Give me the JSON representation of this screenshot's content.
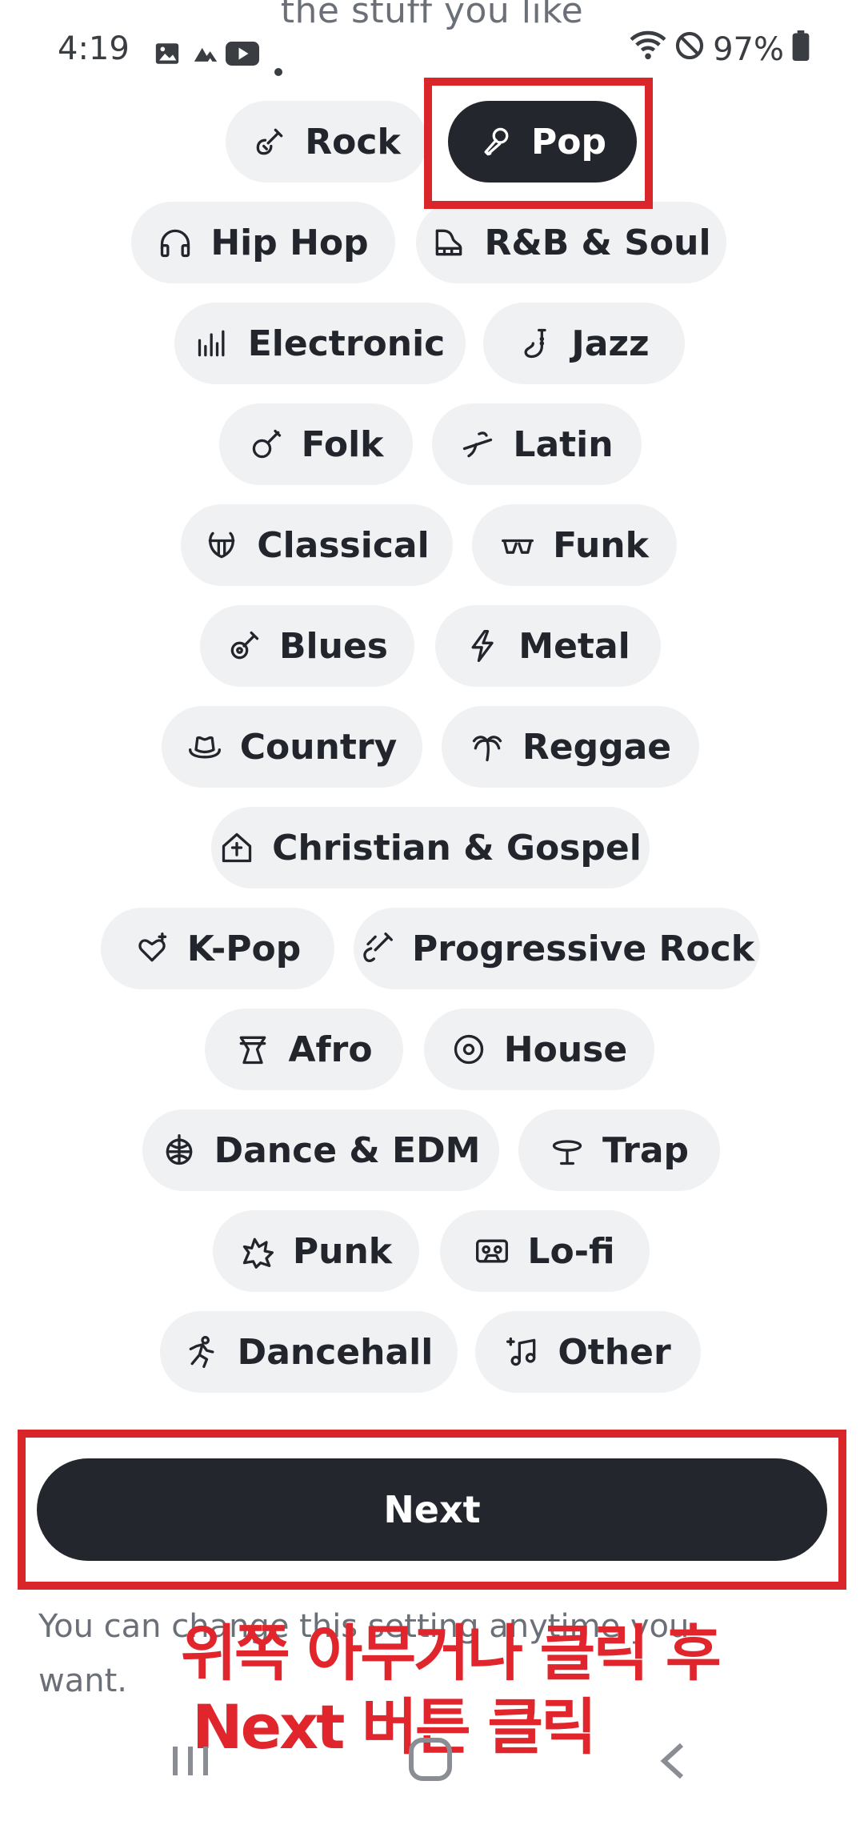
{
  "heading_peek": "the stuff you like",
  "status_bar": {
    "time": "4:19",
    "battery": "97%",
    "icons": [
      "gallery-icon",
      "app-notification-icon",
      "youtube-icon",
      "dot-icon",
      "wifi-icon",
      "do-not-disturb-icon",
      "battery-icon"
    ]
  },
  "genres": [
    {
      "label": "Rock",
      "icon": "electric-guitar-icon",
      "selected": false
    },
    {
      "label": "Pop",
      "icon": "microphone-icon",
      "selected": true
    },
    {
      "label": "Hip Hop",
      "icon": "headphones-icon",
      "selected": false
    },
    {
      "label": "R&B & Soul",
      "icon": "piano-icon",
      "selected": false
    },
    {
      "label": "Electronic",
      "icon": "equalizer-icon",
      "selected": false
    },
    {
      "label": "Jazz",
      "icon": "saxophone-icon",
      "selected": false
    },
    {
      "label": "Folk",
      "icon": "banjo-icon",
      "selected": false
    },
    {
      "label": "Latin",
      "icon": "maracas-icon",
      "selected": false
    },
    {
      "label": "Classical",
      "icon": "lyre-icon",
      "selected": false
    },
    {
      "label": "Funk",
      "icon": "sunglasses-icon",
      "selected": false
    },
    {
      "label": "Blues",
      "icon": "acoustic-guitar-icon",
      "selected": false
    },
    {
      "label": "Metal",
      "icon": "lightning-icon",
      "selected": false
    },
    {
      "label": "Country",
      "icon": "cowboy-hat-icon",
      "selected": false
    },
    {
      "label": "Reggae",
      "icon": "palm-tree-icon",
      "selected": false
    },
    {
      "label": "Christian & Gospel",
      "icon": "church-icon",
      "selected": false
    },
    {
      "label": "K-Pop",
      "icon": "heart-sparkle-icon",
      "selected": false
    },
    {
      "label": "Progressive Rock",
      "icon": "guitar-strum-icon",
      "selected": false
    },
    {
      "label": "Afro",
      "icon": "drum-icon",
      "selected": false
    },
    {
      "label": "House",
      "icon": "vinyl-record-icon",
      "selected": false
    },
    {
      "label": "Dance & EDM",
      "icon": "disco-ball-icon",
      "selected": false
    },
    {
      "label": "Trap",
      "icon": "hi-hat-icon",
      "selected": false
    },
    {
      "label": "Punk",
      "icon": "spiky-burst-icon",
      "selected": false
    },
    {
      "label": "Lo-fi",
      "icon": "cassette-icon",
      "selected": false
    },
    {
      "label": "Dancehall",
      "icon": "dancer-icon",
      "selected": false
    },
    {
      "label": "Other",
      "icon": "music-note-sparkle-icon",
      "selected": false
    }
  ],
  "next_button": {
    "label": "Next"
  },
  "footer_note": "You can change this setting anytime you want.",
  "annotation": {
    "line1": "위쪽 아무거나 클릭 후",
    "line2": "Next 버튼 클릭"
  },
  "colors": {
    "selected_chip": "#23262c",
    "chip": "#f0f1f3",
    "highlight": "#d8262a"
  },
  "nav_bar": {
    "icons": [
      "recent-apps-icon",
      "home-icon",
      "back-icon"
    ]
  }
}
